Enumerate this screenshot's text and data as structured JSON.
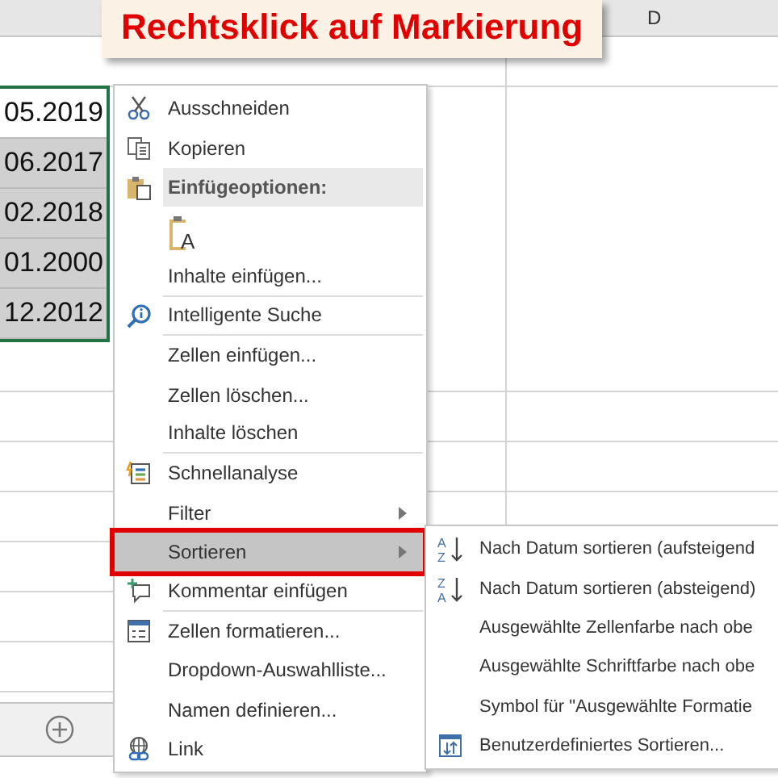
{
  "callout": {
    "text": "Rechtsklick auf Markierung"
  },
  "sheet": {
    "column_header": "D",
    "cells": [
      {
        "value": "05.2019",
        "selected": false
      },
      {
        "value": "06.2017",
        "selected": true
      },
      {
        "value": "02.2018",
        "selected": true
      },
      {
        "value": "01.2000",
        "selected": true
      },
      {
        "value": "12.2012",
        "selected": true
      }
    ]
  },
  "context_menu": {
    "items": [
      {
        "kind": "item",
        "label": "Ausschneiden",
        "selected": false,
        "submenu": false,
        "divider": false
      },
      {
        "kind": "item",
        "label": "Kopieren",
        "selected": false,
        "submenu": false,
        "divider": false
      },
      {
        "kind": "header",
        "label": "Einfügeoptionen:",
        "selected": false,
        "submenu": false,
        "divider": false
      },
      {
        "kind": "paste-options",
        "icon_text": "A",
        "selected": false
      },
      {
        "kind": "item",
        "label": "Inhalte einfügen...",
        "selected": false,
        "submenu": false,
        "divider": true
      },
      {
        "kind": "item",
        "label": "Intelligente Suche",
        "selected": false,
        "submenu": false,
        "divider": true
      },
      {
        "kind": "item",
        "label": "Zellen einfügen...",
        "selected": false,
        "submenu": false,
        "divider": false
      },
      {
        "kind": "item",
        "label": "Zellen löschen...",
        "selected": false,
        "submenu": false,
        "divider": false
      },
      {
        "kind": "item",
        "label": "Inhalte löschen",
        "selected": false,
        "submenu": false,
        "divider": true
      },
      {
        "kind": "item",
        "label": "Schnellanalyse",
        "selected": false,
        "submenu": false,
        "divider": false
      },
      {
        "kind": "item",
        "label": "Filter",
        "selected": false,
        "submenu": true,
        "divider": false
      },
      {
        "kind": "item",
        "label": "Sortieren",
        "selected": true,
        "submenu": true,
        "divider": false
      },
      {
        "kind": "item",
        "label": "Kommentar einfügen",
        "selected": false,
        "submenu": false,
        "divider": true
      },
      {
        "kind": "item",
        "label": "Zellen formatieren...",
        "selected": false,
        "submenu": false,
        "divider": false
      },
      {
        "kind": "item",
        "label": "Dropdown-Auswahlliste...",
        "selected": false,
        "submenu": false,
        "divider": false
      },
      {
        "kind": "item",
        "label": "Namen definieren...",
        "selected": false,
        "submenu": false,
        "divider": false
      },
      {
        "kind": "item",
        "label": "Link",
        "selected": false,
        "submenu": false,
        "divider": false
      }
    ]
  },
  "submenu": {
    "items": [
      {
        "label": "Nach Datum sortieren (aufsteigend",
        "icon_text": [
          "A",
          "Z"
        ]
      },
      {
        "label": "Nach Datum sortieren (absteigend)",
        "icon_text": [
          "Z",
          "A"
        ]
      },
      {
        "label": "Ausgewählte Zellenfarbe nach obe"
      },
      {
        "label": "Ausgewählte Schriftfarbe nach obe"
      },
      {
        "label": "Symbol für \"Ausgewählte Formatie"
      },
      {
        "label": "Benutzerdefiniertes Sortieren..."
      }
    ]
  }
}
